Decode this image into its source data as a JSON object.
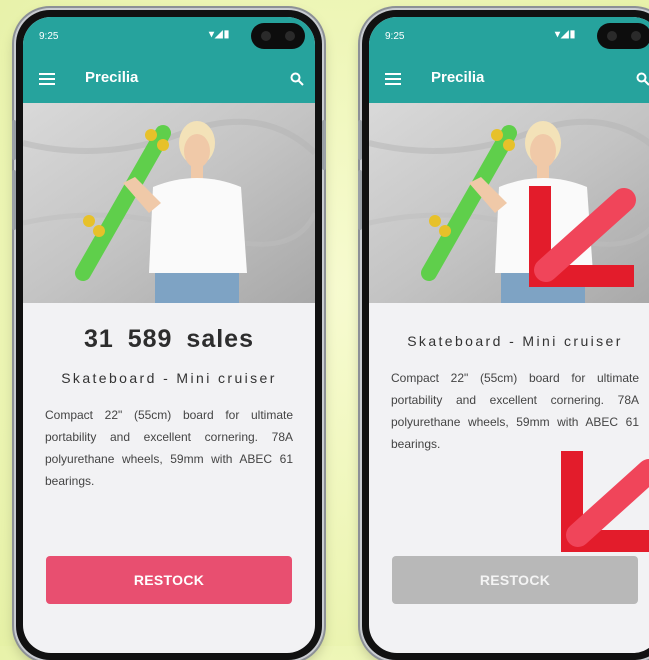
{
  "colors": {
    "appbar": "#26a39d",
    "restock_active": "#e84f70",
    "restock_disabled": "#b8b8b8",
    "arrow": "#e31c2b"
  },
  "left_phone": {
    "status_time": "9:25",
    "app_title": "Precilia",
    "sales": "31 589 sales",
    "product_name": "Skateboard - Mini cruiser",
    "description": "Compact 22\" (55cm) board for ultimate portability and excellent cornering. 78A polyurethane wheels, 59mm with ABEC 61 bearings.",
    "button_label": "RESTOCK"
  },
  "right_phone": {
    "status_time": "9:25",
    "app_title": "Precilia",
    "product_name": "Skateboard - Mini cruiser",
    "description": "Compact 22\" (55cm) board for ultimate portability and excellent cornering. 78A polyurethane wheels, 59mm with ABEC 61 bearings.",
    "button_label": "RESTOCK"
  },
  "icons": [
    "menu-icon",
    "search-icon",
    "signal-icon",
    "battery-icon",
    "camera-icon",
    "arrow-icon"
  ]
}
